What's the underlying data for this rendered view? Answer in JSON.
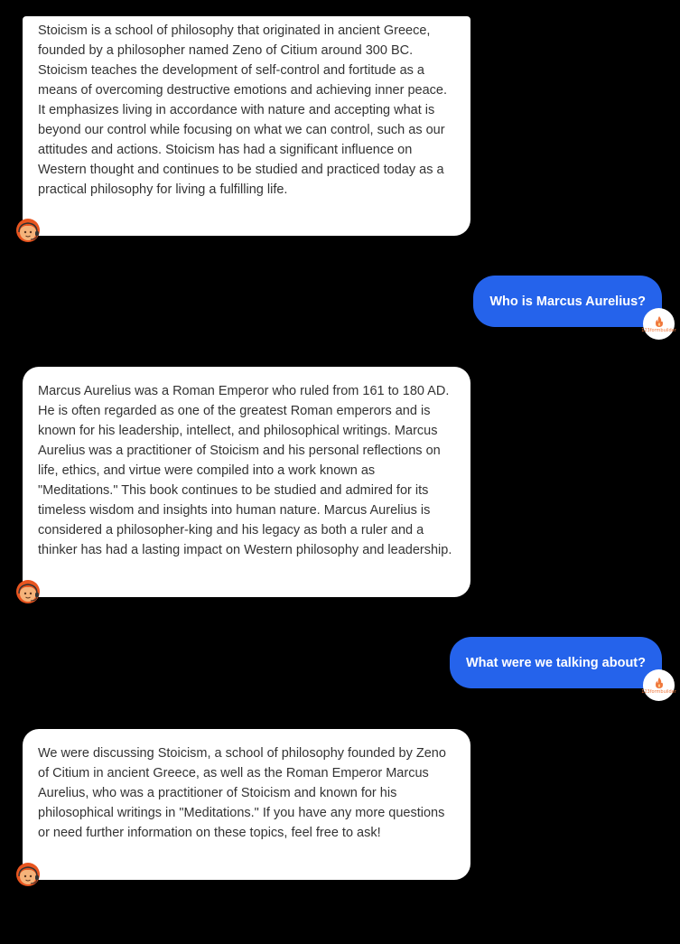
{
  "conversation": {
    "bot_messages": [
      "Stoicism is a school of philosophy that originated in ancient Greece, founded by a philosopher named Zeno of Citium around 300 BC. Stoicism teaches the development of self-control and fortitude as a means of overcoming destructive emotions and achieving inner peace. It emphasizes living in accordance with nature and accepting what is beyond our control while focusing on what we can control, such as our attitudes and actions. Stoicism has had a significant influence on Western thought and continues to be studied and practiced today as a practical philosophy for living a fulfilling life.",
      "Marcus Aurelius was a Roman Emperor who ruled from 161 to 180 AD. He is often regarded as one of the greatest Roman emperors and is known for his leadership, intellect, and philosophical writings. Marcus Aurelius was a practitioner of Stoicism and his personal reflections on life, ethics, and virtue were compiled into a work known as \"Meditations.\" This book continues to be studied and admired for its timeless wisdom and insights into human nature. Marcus Aurelius is considered a philosopher-king and his legacy as both a ruler and a thinker has had a lasting impact on Western philosophy and leadership.",
      "We were discussing Stoicism, a school of philosophy founded by Zeno of Citium in ancient Greece, as well as the Roman Emperor Marcus Aurelius, who was a practitioner of Stoicism and known for his philosophical writings in \"Meditations.\" If you have any more questions or need further information on these topics, feel free to ask!"
    ],
    "user_messages": [
      "Who is Marcus Aurelius?",
      "What were we talking about?"
    ],
    "user_avatar_logo_text": "123formbuilder",
    "bot_avatar_icon": "support-agent-icon",
    "user_avatar_icon": "flame-logo-icon"
  },
  "colors": {
    "background": "#000000",
    "bot_bubble": "#ffffff",
    "bot_text": "#333333",
    "user_bubble": "#2563eb",
    "user_text": "#ffffff",
    "avatar_hair": "#e8551f",
    "avatar_skin": "#f5b37a",
    "logo_orange": "#f0783c"
  }
}
